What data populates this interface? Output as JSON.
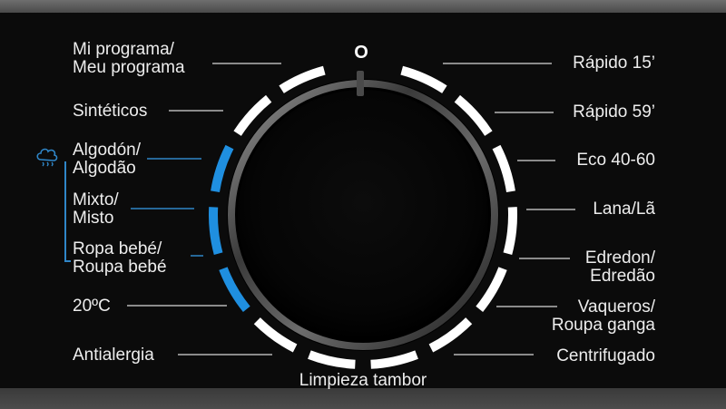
{
  "panel": {
    "dial_zero_label": "O"
  },
  "programs_left": [
    {
      "line1": "Mi programa/",
      "line2": "Meu programa"
    },
    {
      "line1": "Sintéticos",
      "line2": ""
    },
    {
      "line1": "Algodón/",
      "line2": "Algodão"
    },
    {
      "line1": "Mixto/",
      "line2": "Misto"
    },
    {
      "line1": "Ropa bebé/",
      "line2": "Roupa bebé"
    },
    {
      "line1": "20ºC",
      "line2": ""
    },
    {
      "line1": "Antialergia",
      "line2": ""
    }
  ],
  "programs_right": [
    {
      "line1": "Rápido 15’",
      "line2": ""
    },
    {
      "line1": "Rápido 59’",
      "line2": ""
    },
    {
      "line1": "Eco 40-60",
      "line2": ""
    },
    {
      "line1": "Lana/Lã",
      "line2": ""
    },
    {
      "line1": "Edredon/",
      "line2": "Edredão"
    },
    {
      "line1": "Vaqueros/",
      "line2": "Roupa ganga"
    },
    {
      "line1": "Centrifugado",
      "line2": ""
    }
  ],
  "program_bottom": {
    "line1": "Limpieza tambor"
  },
  "icons": {
    "steam_group": "cloud-steam-icon"
  },
  "colors": {
    "panel_bg": "#0b0b0b",
    "label_text": "#ededed",
    "segment_white": "#ffffff",
    "segment_blue": "#1f8fe0",
    "bracket_blue": "#2f86c8"
  }
}
